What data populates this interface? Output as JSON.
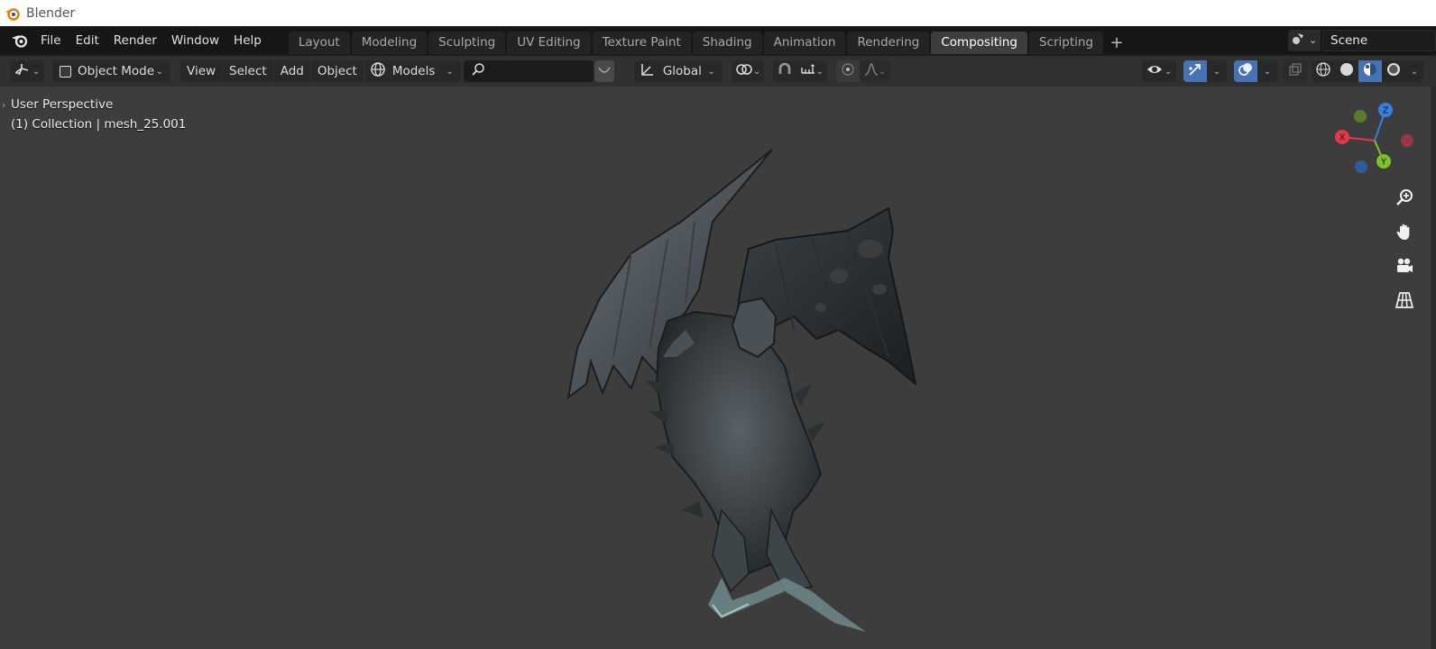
{
  "window": {
    "title": "Blender"
  },
  "menus": [
    "File",
    "Edit",
    "Render",
    "Window",
    "Help"
  ],
  "workspaces": {
    "tabs": [
      "Layout",
      "Modeling",
      "Sculpting",
      "UV Editing",
      "Texture Paint",
      "Shading",
      "Animation",
      "Rendering",
      "Compositing",
      "Scripting"
    ],
    "active": "Compositing",
    "add_icon": "plus-icon"
  },
  "scene": {
    "name": "Scene",
    "icon": "scene-icon"
  },
  "header": {
    "editor_type_icon": "3d-viewport-icon",
    "mode": "Object Mode",
    "view_menus": [
      "View",
      "Select",
      "Add",
      "Object"
    ],
    "collection": "Models",
    "search_placeholder": "",
    "transform_orientation": "Global",
    "pivot_icon": "pivot-point-icon",
    "snap_icon": "snap-magnet-icon",
    "snap_increment_icon": "snap-increment-icon",
    "proportional_icon": "proportional-edit-icon",
    "falloff_icon": "falloff-curve-icon",
    "visibility_icon": "eye-icon",
    "gizmo_icon": "gizmo-arrow-icon",
    "overlay_icon": "overlay-circles-icon",
    "xray_icon": "xray-icon",
    "shading_modes": [
      "wireframe",
      "solid",
      "material-preview",
      "rendered"
    ],
    "shading_active": "material-preview"
  },
  "viewport": {
    "perspective_label": "User Perspective",
    "object_label": "(1) Collection | mesh_25.001",
    "gizmo_axes": [
      "X",
      "Y",
      "Z"
    ],
    "axis_colors": {
      "x": "#e8374c",
      "y": "#7bc326",
      "z": "#3580e0",
      "x_neg": "#9b3444",
      "y_neg": "#5b7a2c",
      "z_neg": "#2f5a9b"
    },
    "nav_buttons": [
      "zoom-icon",
      "hand-pan-icon",
      "camera-icon",
      "grid-ortho-icon"
    ],
    "background_color": "#3d3d3d"
  }
}
